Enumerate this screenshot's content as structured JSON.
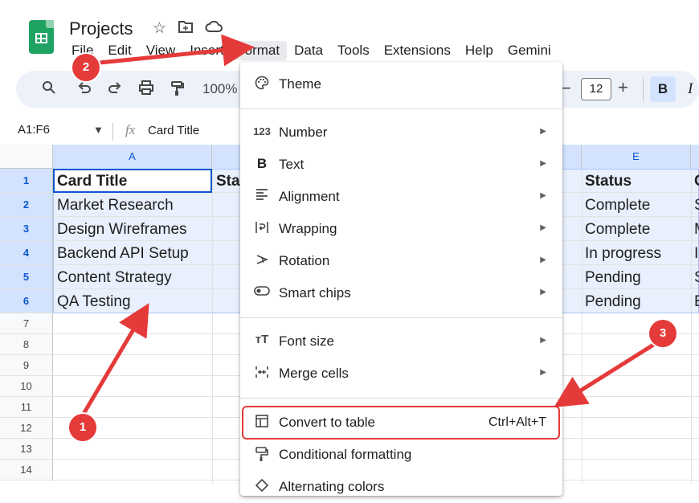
{
  "app": {
    "title": "Projects",
    "title_icons": [
      "star-icon",
      "folder-icon",
      "cloud-icon"
    ]
  },
  "menubar": [
    "File",
    "Edit",
    "View",
    "Insert",
    "Format",
    "Data",
    "Tools",
    "Extensions",
    "Help",
    "Gemini"
  ],
  "toolbar": {
    "zoom": "100%",
    "font_size": "12",
    "bold": "B",
    "italic": "I",
    "minus": "−",
    "plus": "+"
  },
  "formula_bar": {
    "name_box": "A1:F6",
    "value": "Card Title"
  },
  "grid": {
    "col_headers": [
      "A",
      "E"
    ],
    "row_numbers": [
      "1",
      "2",
      "3",
      "4",
      "5",
      "6",
      "7",
      "8",
      "9",
      "10",
      "11",
      "12",
      "13",
      "14"
    ],
    "col_a": [
      "Card Title",
      "Market Research",
      "Design Wireframes",
      "Backend API Setup",
      "Content Strategy",
      "QA Testing"
    ],
    "col_b_partial": "Sta",
    "col_e": [
      "Status",
      "Complete",
      "Complete",
      "In progress",
      "Pending",
      "Pending"
    ],
    "col_f_partial": [
      "C",
      "S",
      "M",
      "I",
      "S",
      "E"
    ]
  },
  "format_menu": {
    "theme": "Theme",
    "number": "Number",
    "text": "Text",
    "alignment": "Alignment",
    "wrapping": "Wrapping",
    "rotation": "Rotation",
    "smart_chips": "Smart chips",
    "font_size": "Font size",
    "merge_cells": "Merge cells",
    "convert_to_table": "Convert to table",
    "convert_shortcut": "Ctrl+Alt+T",
    "conditional_formatting": "Conditional formatting",
    "alternating_colors": "Alternating colors"
  },
  "annotations": {
    "step1": "1",
    "step2": "2",
    "step3": "3",
    "color": "#e53a3a"
  }
}
